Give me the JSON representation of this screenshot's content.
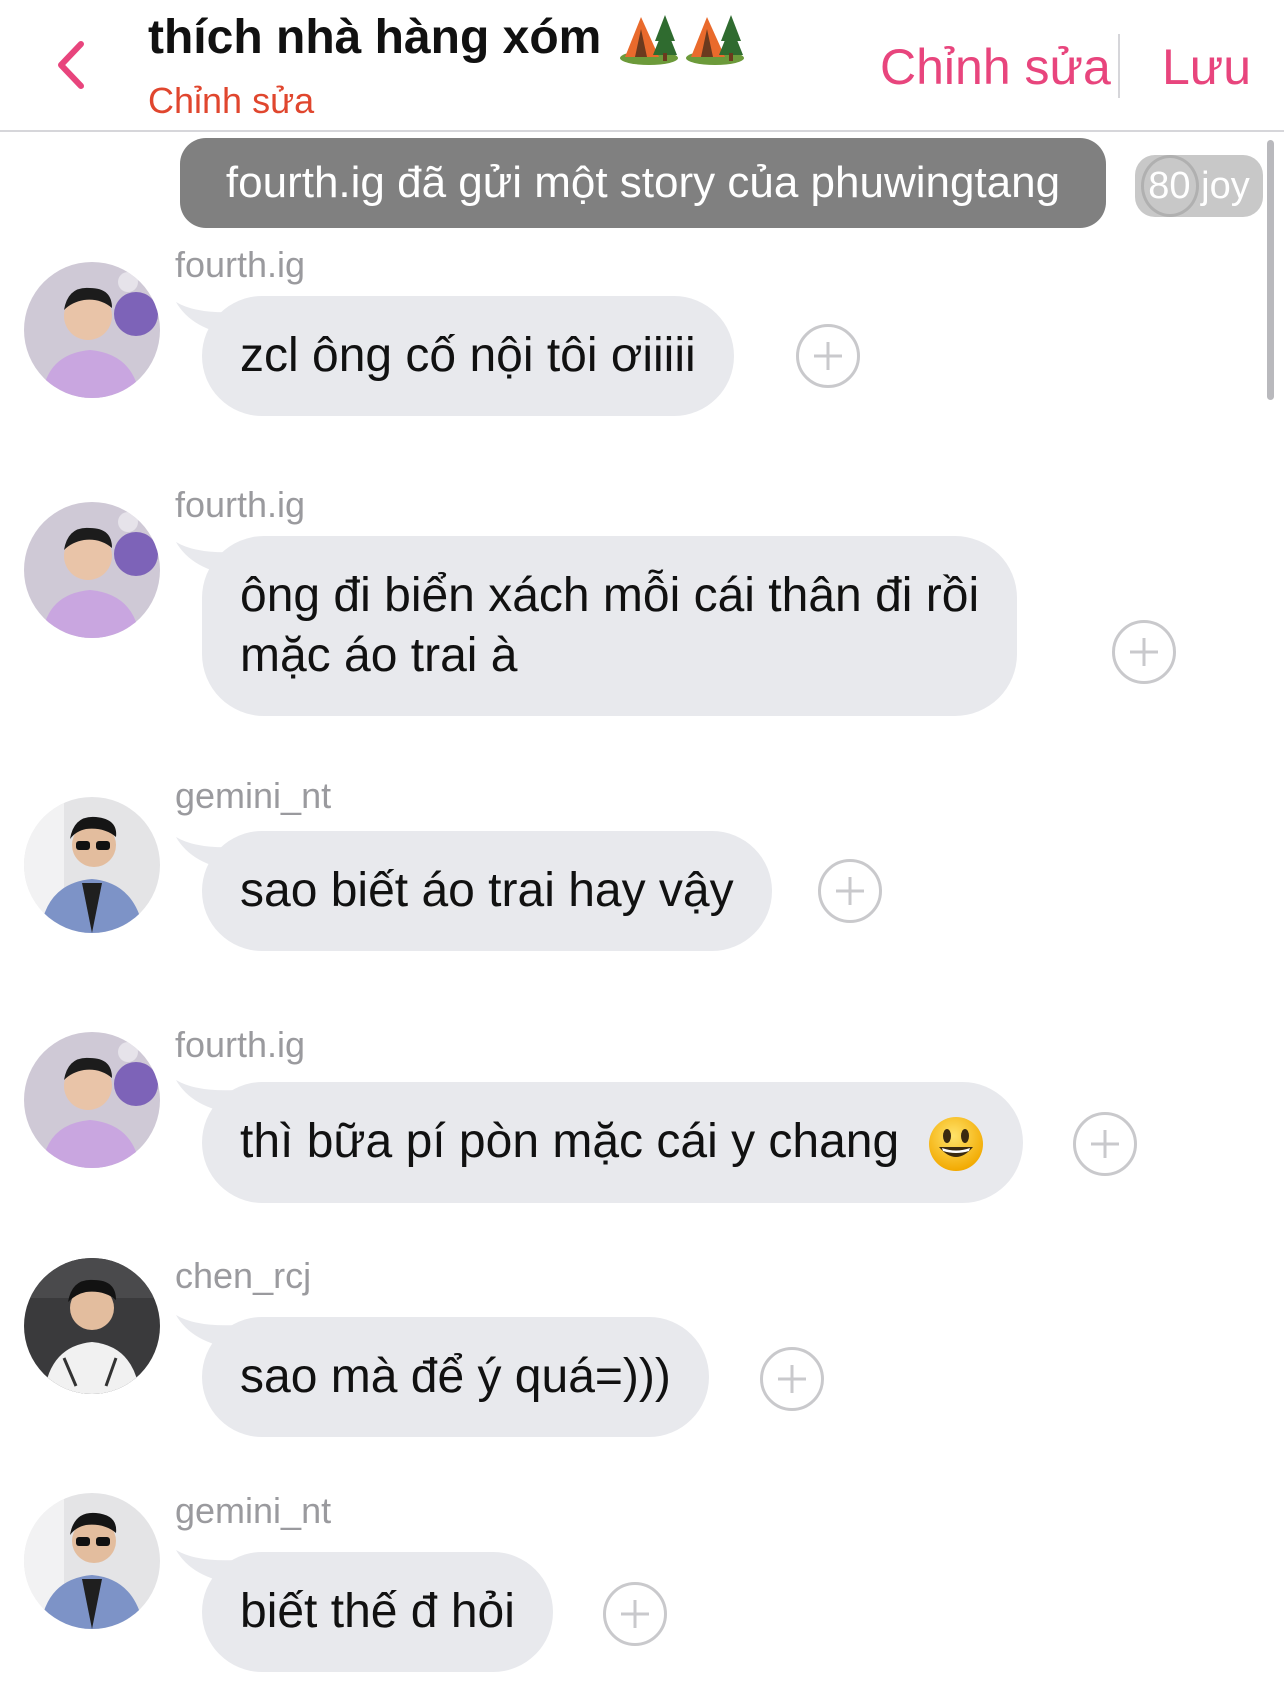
{
  "header": {
    "title": "thích nhà hàng xóm",
    "title_icons": [
      "camping-tent-icon",
      "camping-tent-icon"
    ],
    "subtitle": "Chỉnh sửa",
    "edit_label": "Chỉnh sửa",
    "save_label": "Lưu"
  },
  "story_notice": {
    "text": "fourth.ig đã gửi một story của phuwingtang",
    "badge": "80 joy"
  },
  "messages": [
    {
      "sender": "fourth.ig",
      "lines": [
        "zcl ông cố nội tôi ơiiiii"
      ]
    },
    {
      "sender": "fourth.ig",
      "lines": [
        "ông đi biển xách mỗi cái thân đi rồi",
        "mặc áo trai à"
      ]
    },
    {
      "sender": "gemini_nt",
      "lines": [
        "sao biết áo trai hay vậy"
      ]
    },
    {
      "sender": "fourth.ig",
      "lines": [
        "thì bữa pí pòn mặc cái y chang"
      ],
      "emoji": "smiley-face-icon"
    },
    {
      "sender": "chen_rcj",
      "lines": [
        "sao mà để ý quá=)))"
      ]
    },
    {
      "sender": "gemini_nt",
      "lines": [
        "biết thế đ hỏi"
      ]
    }
  ],
  "colors": {
    "accent": "#e8457d",
    "subtitle": "#e0462e",
    "bubble": "#e8e9ed",
    "story_pill": "#808080",
    "sender": "#9a9a9e"
  }
}
